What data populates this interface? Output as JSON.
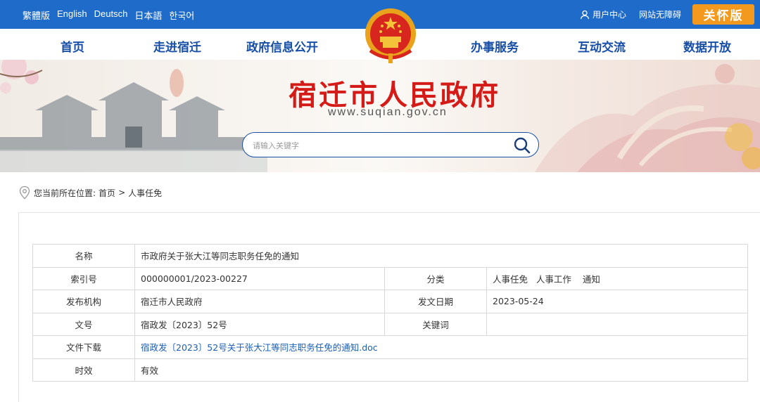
{
  "top_bar": {
    "languages": [
      "繁體版",
      "English",
      "Deutsch",
      "日本語",
      "한국어"
    ],
    "user_center": "用户中心",
    "accessibility": "网站无障碍",
    "care_mode": "关怀版"
  },
  "nav": {
    "items": [
      "首页",
      "走进宿迁",
      "政府信息公开",
      "办事服务",
      "互动交流",
      "数据开放"
    ]
  },
  "banner": {
    "title": "宿迁市人民政府",
    "url": "www.suqian.gov.cn",
    "search_placeholder": "请输入关键字"
  },
  "breadcrumb": {
    "prefix": "您当前所在位置:",
    "items": [
      "首页",
      "人事任免"
    ],
    "separator": ">"
  },
  "info_table": {
    "name_label": "名称",
    "name_value": "市政府关于张大江等同志职务任免的通知",
    "index_label": "索引号",
    "index_value": "000000001/2023-00227",
    "category_label": "分类",
    "category_value": "人事任免   人事工作    通知",
    "publisher_label": "发布机构",
    "publisher_value": "宿迁市人民政府",
    "date_label": "发文日期",
    "date_value": "2023-05-24",
    "docno_label": "文号",
    "docno_value": "宿政发〔2023〕52号",
    "keywords_label": "关键词",
    "keywords_value": "",
    "download_label": "文件下载",
    "download_value": "宿政发〔2023〕52号关于张大江等同志职务任免的通知.doc",
    "validity_label": "时效",
    "validity_value": "有效"
  },
  "colors": {
    "top_bar": "#1e6bc9",
    "nav_text": "#174ea6",
    "title_red": "#d41b18",
    "care_orange": "#f39a1e",
    "link_blue": "#1c5fb5"
  }
}
